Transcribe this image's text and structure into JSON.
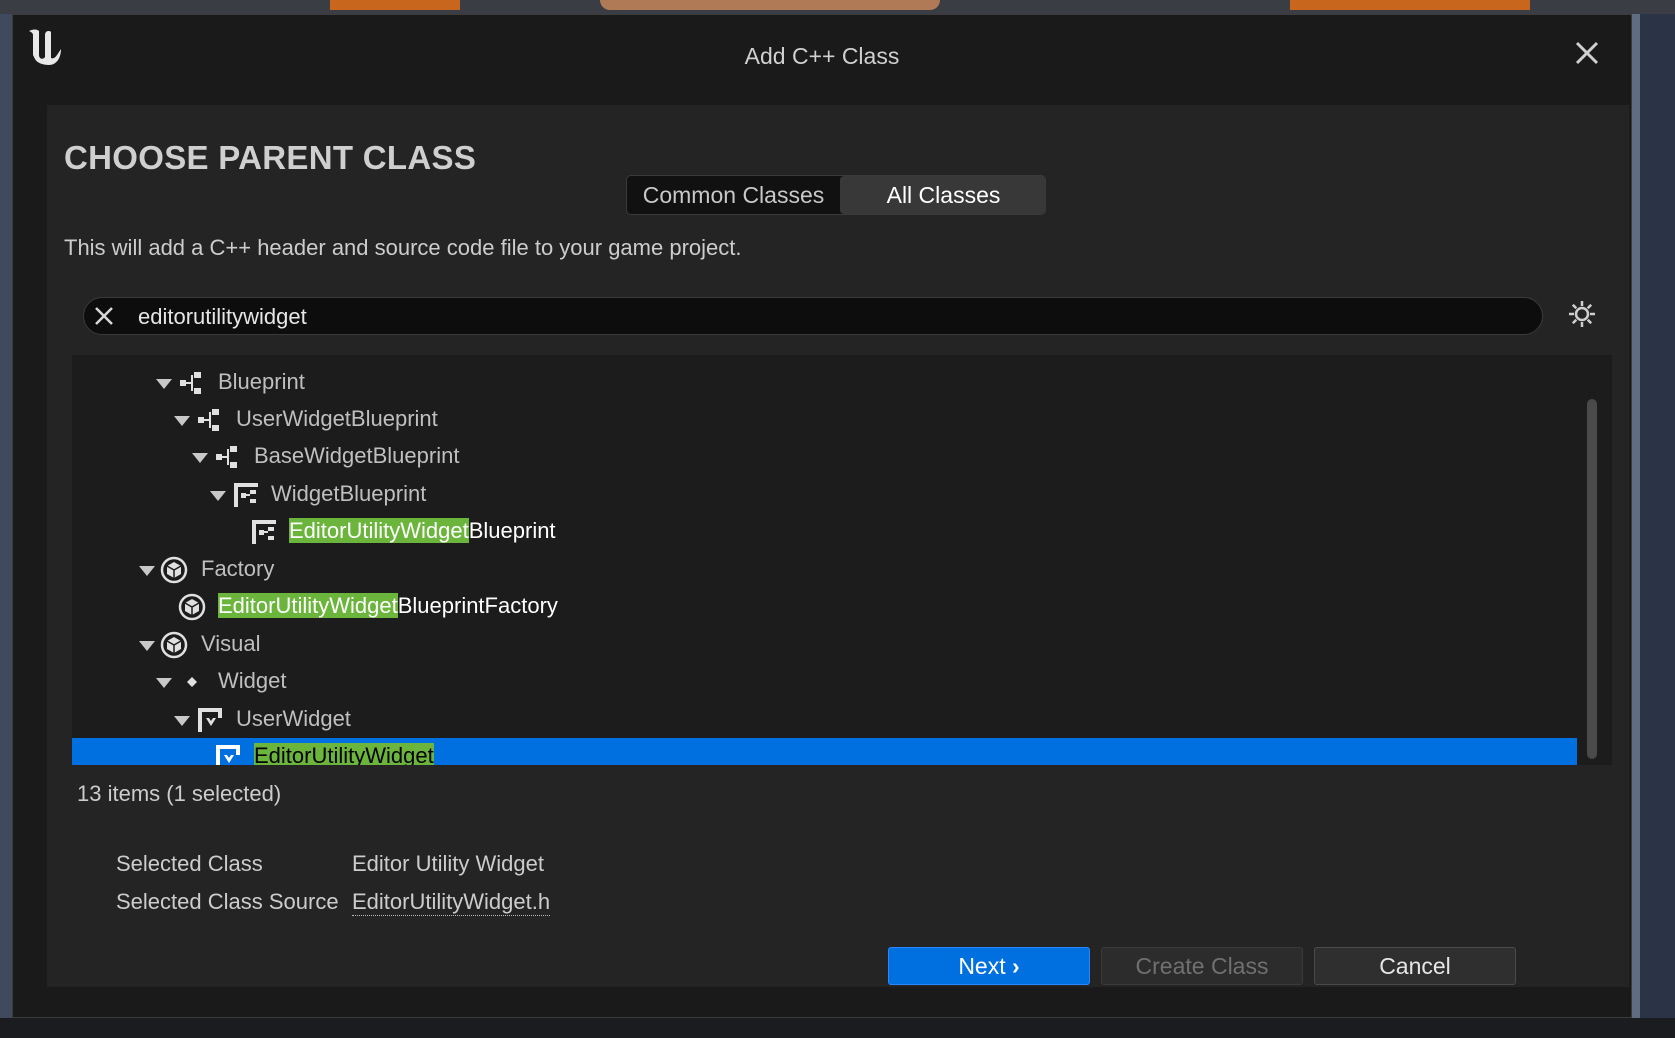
{
  "window": {
    "title": "Add C++ Class"
  },
  "header": {
    "heading": "CHOOSE PARENT CLASS",
    "tabs": [
      "Common Classes",
      "All Classes"
    ],
    "active_tab": "All Classes",
    "description": "This will add a C++ header and source code file to your game project."
  },
  "search": {
    "value": "editorutilitywidget"
  },
  "tree": {
    "rows": [
      {
        "label": "Blueprint",
        "highlight": "",
        "rest": "Blueprint",
        "icon": "blueprint-hierarchy-icon",
        "expanded": true
      },
      {
        "label": "UserWidgetBlueprint",
        "highlight": "",
        "rest": "UserWidgetBlueprint",
        "icon": "blueprint-hierarchy-icon",
        "expanded": true
      },
      {
        "label": "BaseWidgetBlueprint",
        "highlight": "",
        "rest": "BaseWidgetBlueprint",
        "icon": "blueprint-hierarchy-icon",
        "expanded": true
      },
      {
        "label": "WidgetBlueprint",
        "highlight": "",
        "rest": "WidgetBlueprint",
        "icon": "widget-blueprint-icon",
        "expanded": true
      },
      {
        "label": "EditorUtilityWidgetBlueprint",
        "highlight": "EditorUtilityWidget",
        "rest": "Blueprint",
        "icon": "widget-blueprint-icon",
        "expanded": false
      },
      {
        "label": "Factory",
        "highlight": "",
        "rest": "Factory",
        "icon": "class-cube-icon",
        "expanded": true
      },
      {
        "label": "EditorUtilityWidgetBlueprintFactory",
        "highlight": "EditorUtilityWidget",
        "rest": "BlueprintFactory",
        "icon": "class-cube-icon",
        "expanded": false
      },
      {
        "label": "Visual",
        "highlight": "",
        "rest": "Visual",
        "icon": "class-cube-icon",
        "expanded": true
      },
      {
        "label": "Widget",
        "highlight": "",
        "rest": "Widget",
        "icon": "diamond-icon",
        "expanded": true
      },
      {
        "label": "UserWidget",
        "highlight": "",
        "rest": "UserWidget",
        "icon": "user-widget-icon",
        "expanded": true
      },
      {
        "label": "EditorUtilityWidget",
        "highlight": "EditorUtilityWidget",
        "rest": "",
        "icon": "user-widget-icon",
        "expanded": false,
        "selected": true
      }
    ],
    "status": "13 items (1 selected)"
  },
  "details": {
    "selected_class_label": "Selected Class",
    "selected_class_value": "Editor Utility Widget",
    "selected_source_label": "Selected Class Source",
    "selected_source_value": "EditorUtilityWidget.h"
  },
  "buttons": {
    "next": "Next",
    "create": "Create Class",
    "cancel": "Cancel"
  },
  "colors": {
    "accent": "#0070e0",
    "highlight": "#6bb53c",
    "background": "#242424"
  }
}
